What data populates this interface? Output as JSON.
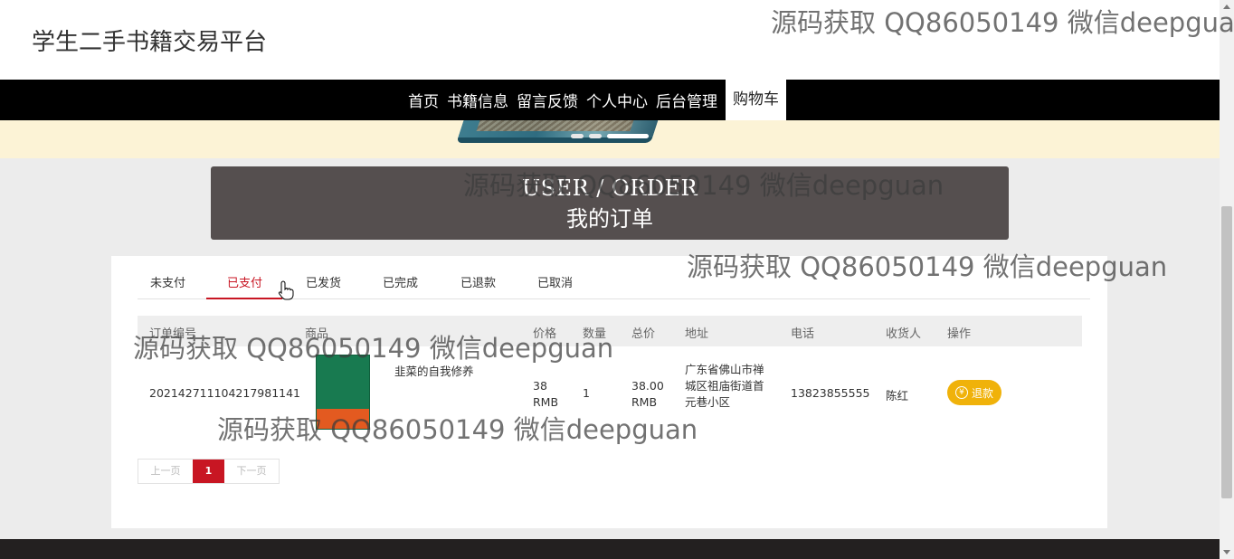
{
  "site": {
    "title": "学生二手书籍交易平台"
  },
  "nav": {
    "items": [
      "首页",
      "书籍信息",
      "留言反馈",
      "个人中心",
      "后台管理"
    ],
    "cart": "购物车"
  },
  "header": {
    "en": "USER / ORDER",
    "cn": "我的订单"
  },
  "tabs": {
    "items": [
      "未支付",
      "已支付",
      "已发货",
      "已完成",
      "已退款",
      "已取消"
    ],
    "active_index": 1
  },
  "table": {
    "columns": [
      "订单编号",
      "商品",
      "价格",
      "数量",
      "总价",
      "地址",
      "电话",
      "收货人",
      "操作"
    ],
    "rows": [
      {
        "order_no": "202142711104217981141",
        "book_title": "韭菜的自我修养",
        "price": "38 RMB",
        "quantity": "1",
        "total": "38.00 RMB",
        "address": "广东省佛山市禅城区祖庙街道首元巷小区",
        "phone": "13823855555",
        "receiver": "陈红",
        "action": "退款"
      }
    ]
  },
  "pagination": {
    "prev": "上一页",
    "current": "1",
    "next": "下一页"
  },
  "watermark": "源码获取 QQ86050149 微信deepguan",
  "colors": {
    "accent": "#c81623",
    "refund_button": "#f0b20a",
    "nav_bg": "#000000",
    "header_bg": "#554f4f"
  },
  "icons": {
    "refund": "yen-icon"
  }
}
